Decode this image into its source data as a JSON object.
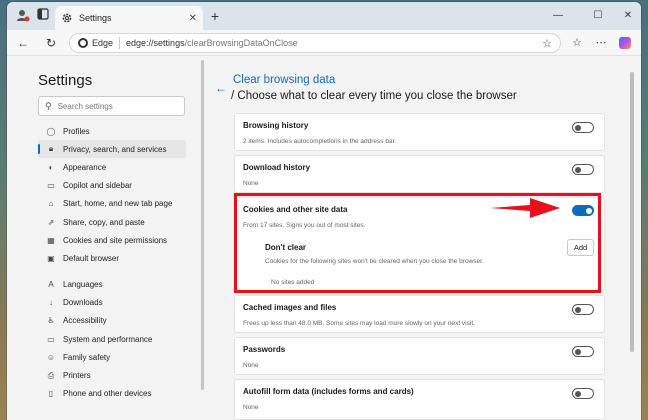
{
  "tab": {
    "title": "Settings",
    "close": "✕"
  },
  "window_controls": {
    "minimize": "—",
    "maximize": "☐",
    "close": "✕"
  },
  "address": {
    "badge": "Edge",
    "url_main": "edge://settings",
    "url_rest": "/clearBrowsingDataOnClose"
  },
  "sidebar": {
    "title": "Settings",
    "search_placeholder": "Search settings",
    "items": [
      {
        "label": "Profiles",
        "icon": "profile-icon",
        "active": false
      },
      {
        "label": "Privacy, search, and services",
        "icon": "lock-icon",
        "active": true
      },
      {
        "label": "Appearance",
        "icon": "appearance-icon",
        "active": false
      },
      {
        "label": "Copilot and sidebar",
        "icon": "sidebar-icon",
        "active": false
      },
      {
        "label": "Start, home, and new tab page",
        "icon": "home-icon",
        "active": false
      },
      {
        "label": "Share, copy, and paste",
        "icon": "share-icon",
        "active": false
      },
      {
        "label": "Cookies and site permissions",
        "icon": "permissions-icon",
        "active": false
      },
      {
        "label": "Default browser",
        "icon": "browser-icon",
        "active": false
      },
      {
        "label": "Languages",
        "icon": "languages-icon",
        "active": false
      },
      {
        "label": "Downloads",
        "icon": "download-icon",
        "active": false
      },
      {
        "label": "Accessibility",
        "icon": "accessibility-icon",
        "active": false
      },
      {
        "label": "System and performance",
        "icon": "system-icon",
        "active": false
      },
      {
        "label": "Family safety",
        "icon": "family-icon",
        "active": false
      },
      {
        "label": "Printers",
        "icon": "printer-icon",
        "active": false
      },
      {
        "label": "Phone and other devices",
        "icon": "phone-icon",
        "active": false
      }
    ]
  },
  "main": {
    "title": "Clear browsing data",
    "subtitle": "/ Choose what to clear every time you close the browser",
    "rows": {
      "browsing_history": {
        "title": "Browsing history",
        "desc": "2 items. Includes autocompletions in the address bar.",
        "on": false
      },
      "download_history": {
        "title": "Download history",
        "desc": "None",
        "on": false
      },
      "cookies": {
        "title": "Cookies and other site data",
        "desc": "From 17 sites. Signs you out of most sites.",
        "on": true
      },
      "dont_clear": {
        "title": "Don't clear",
        "desc": "Cookies for the following sites won't be cleared when you close the browser.",
        "add_label": "Add",
        "empty": "No sites added"
      },
      "cached": {
        "title": "Cached images and files",
        "desc": "Frees up less than 48.0 MB. Some sites may load more slowly on your next visit.",
        "on": false
      },
      "passwords": {
        "title": "Passwords",
        "desc": "None",
        "on": false
      },
      "autofill": {
        "title": "Autofill form data (includes forms and cards)",
        "desc": "None",
        "on": false
      }
    }
  },
  "colors": {
    "accent": "#0f6cbd",
    "highlight": "#e8101a"
  }
}
